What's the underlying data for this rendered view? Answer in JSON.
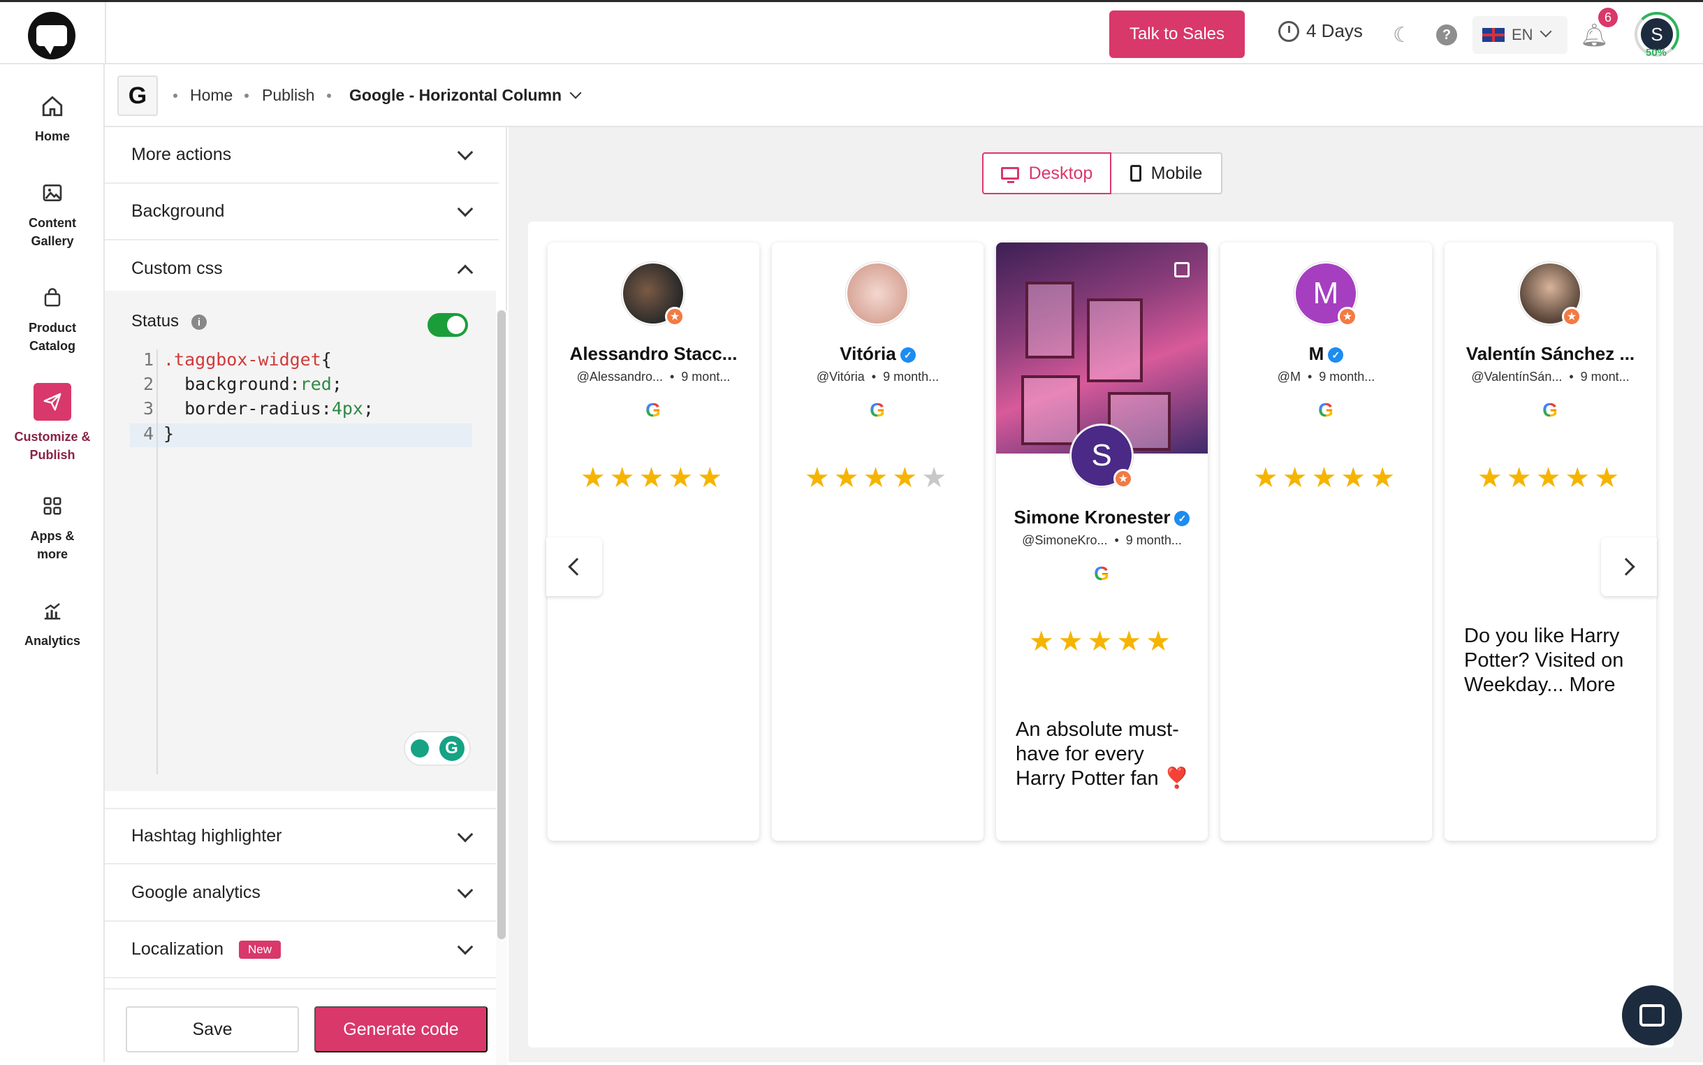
{
  "header": {
    "sales_label": "Talk to Sales",
    "trial_label": "4 Days",
    "language": "EN",
    "notifications": "6",
    "avatar_initial": "S",
    "progress_label": "50%",
    "progress_value": 0.5
  },
  "sidebar": {
    "items": [
      {
        "label": "Home",
        "icon": "home-icon"
      },
      {
        "label": "Content Gallery",
        "icon": "image-icon"
      },
      {
        "label": "Product Catalog",
        "icon": "bag-icon"
      },
      {
        "label": "Customize & Publish",
        "icon": "send-icon"
      },
      {
        "label": "Apps & more",
        "icon": "grid-icon"
      },
      {
        "label": "Analytics",
        "icon": "analytics-icon"
      }
    ]
  },
  "breadcrumb": {
    "badge": "G",
    "home": "Home",
    "publish": "Publish",
    "current": "Google - Horizontal Column"
  },
  "panel": {
    "more_actions": "More actions",
    "background": "Background",
    "custom_css": "Custom css",
    "status_label": "Status",
    "status_on": true,
    "code_lines": [
      {
        "num": "1",
        "sel": ".taggbox-widget",
        "rest": "{"
      },
      {
        "num": "2",
        "prop": "  background:",
        "val": "red",
        "end": ";"
      },
      {
        "num": "3",
        "prop": "  border-radius:",
        "val": "4px",
        "end": ";"
      },
      {
        "num": "4",
        "rest": "}"
      }
    ],
    "hashtag": "Hashtag highlighter",
    "analytics": "Google analytics",
    "localization": "Localization",
    "new_badge": "New",
    "save": "Save",
    "generate": "Generate code"
  },
  "preview": {
    "desktop": "Desktop",
    "mobile": "Mobile",
    "cards": [
      {
        "name": "Alessandro Stacc...",
        "handle": "@Alessandro...",
        "time": "9 mont...",
        "rating": 5
      },
      {
        "name": "Vitória",
        "handle": "@Vitória",
        "time": "9 month...",
        "rating": 4,
        "verified": true
      },
      {
        "name": "Simone Kronester",
        "handle": "@SimoneKro...",
        "time": "9 month...",
        "rating": 5,
        "verified": true,
        "initial": "S",
        "text": "An absolute must-have for every Harry Potter fan ❣️"
      },
      {
        "name": "M",
        "handle": "@M",
        "time": "9 month...",
        "rating": 5,
        "verified": true,
        "initial": "M"
      },
      {
        "name": "Valentín Sánchez ...",
        "handle": "@ValentínSán...",
        "time": "9 mont...",
        "rating": 5,
        "text": "Do you like Harry Potter? Visited on Weekday... More"
      }
    ]
  },
  "colors": {
    "accent": "#d9386a",
    "star": "#f5b400",
    "toggle": "#1b9e3a"
  }
}
